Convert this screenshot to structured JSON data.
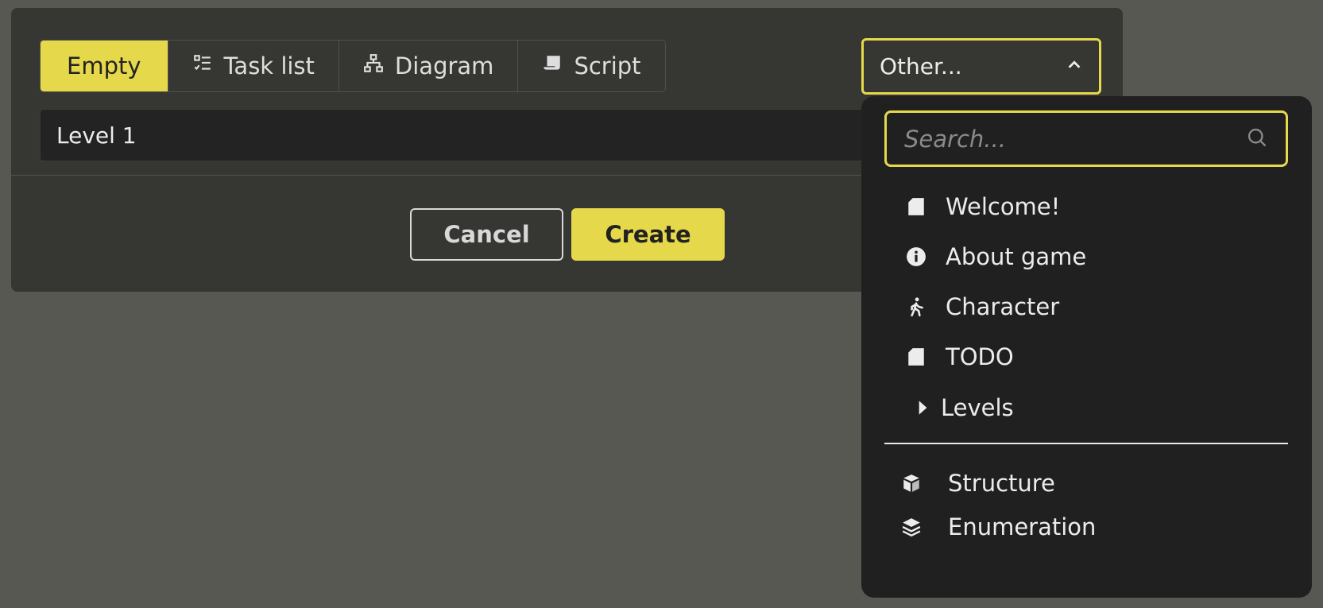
{
  "tabs": [
    {
      "label": "Empty",
      "icon": null,
      "active": true
    },
    {
      "label": "Task list",
      "icon": "checklist-icon",
      "active": false
    },
    {
      "label": "Diagram",
      "icon": "diagram-icon",
      "active": false
    },
    {
      "label": "Script",
      "icon": "scroll-icon",
      "active": false
    }
  ],
  "other_select": {
    "label": "Other...",
    "icon": "chevron-up-icon"
  },
  "name_input": {
    "value": "Level 1"
  },
  "buttons": {
    "cancel": "Cancel",
    "create": "Create"
  },
  "dropdown": {
    "search_placeholder": "Search...",
    "items": [
      {
        "label": "Welcome!",
        "icon": "document-icon"
      },
      {
        "label": "About game",
        "icon": "info-icon"
      },
      {
        "label": "Character",
        "icon": "walking-person-icon"
      },
      {
        "label": "TODO",
        "icon": "document-icon"
      },
      {
        "label": "Levels",
        "icon": "caret-right-icon"
      }
    ],
    "types": [
      {
        "label": "Structure",
        "icon": "cube-icon"
      },
      {
        "label": "Enumeration",
        "icon": "layers-icon"
      }
    ]
  },
  "colors": {
    "accent": "#e6d84b",
    "background": "#575851",
    "dialog": "#363632",
    "dropdown": "#202020"
  }
}
